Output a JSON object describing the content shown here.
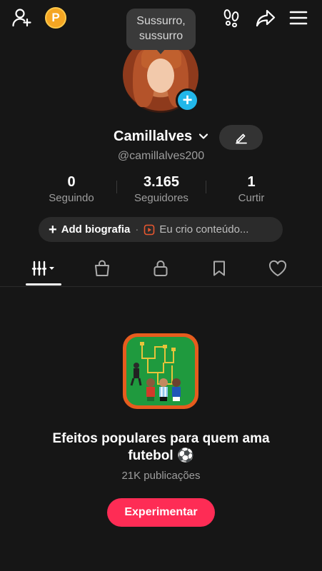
{
  "header": {
    "add_friend_icon": "person-plus-icon",
    "coin_letter": "P",
    "footprints_icon": "footprints-icon",
    "share_icon": "share-arrow-icon",
    "menu_icon": "hamburger-menu-icon"
  },
  "tooltip": {
    "line1": "Sussurro,",
    "line2": "sussurro"
  },
  "profile": {
    "display_name": "Camillalves",
    "handle": "@camillalves200",
    "avatar_add_symbol": "+"
  },
  "stats": [
    {
      "value": "0",
      "label": "Seguindo"
    },
    {
      "value": "3.165",
      "label": "Seguidores"
    },
    {
      "value": "1",
      "label": "Curtir"
    }
  ],
  "bio": {
    "add_label": "Add biografia",
    "dot": "·",
    "link_text": "Eu crio conteúdo..."
  },
  "tabs": [
    {
      "name": "grid-filter-icon",
      "active": true
    },
    {
      "name": "shopping-bag-icon"
    },
    {
      "name": "lock-icon"
    },
    {
      "name": "bookmark-icon"
    },
    {
      "name": "heart-icon"
    }
  ],
  "effect": {
    "title_line1": "Efeitos populares para quem ama",
    "title_line2": "futebol ⚽",
    "subtitle": "21K publicações",
    "button_label": "Experimentar"
  },
  "colors": {
    "background": "#161616",
    "accent_button": "#fe2c55",
    "avatar_plus": "#22b7ea",
    "coin": "#f5a623"
  }
}
